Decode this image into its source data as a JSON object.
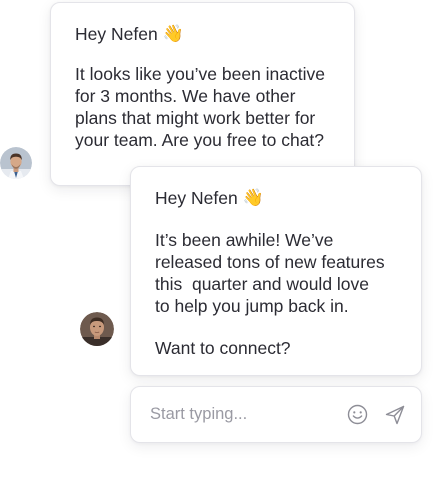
{
  "messages": [
    {
      "greeting": "Hey Nefen",
      "greeting_emoji": "👋",
      "body": "It looks like you’ve been inactive\nfor 3 months. We have other\nplans that might work better for\nyour team. Are you free to chat?"
    },
    {
      "greeting": "Hey Nefen",
      "greeting_emoji": "👋",
      "body": "It’s been awhile! We’ve\nreleased tons of new features\nthis  quarter and would love\nto help you jump back in.",
      "body_2": "Want to connect?"
    }
  ],
  "composer": {
    "placeholder": "Start typing...",
    "emoji_icon": "smiley-icon",
    "send_icon": "send-icon"
  },
  "colors": {
    "text": "#2b2b33",
    "border": "#e4e4e9",
    "placeholder": "#9a9aa3",
    "icon": "#8d8d96"
  }
}
